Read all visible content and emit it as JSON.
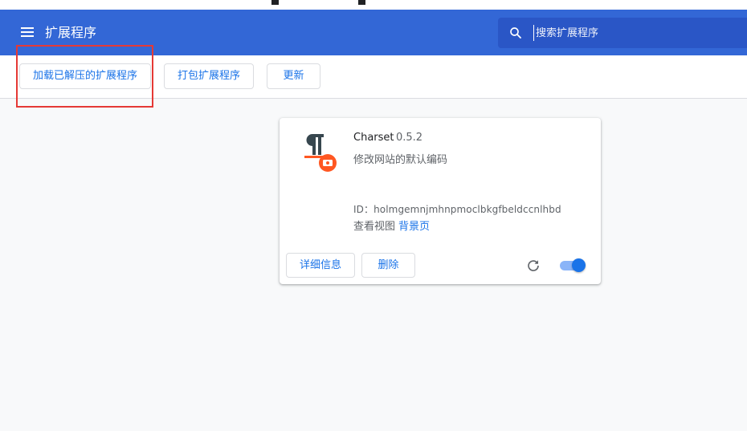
{
  "header": {
    "title": "扩展程序",
    "search_placeholder": "搜索扩展程序"
  },
  "toolbar": {
    "load_unpacked_label": "加载已解压的扩展程序",
    "pack_label": "打包扩展程序",
    "update_label": "更新"
  },
  "extension": {
    "name": "Charset",
    "version": "0.5.2",
    "description": "修改网站的默认编码",
    "id_text": "ID：holmgemnjmhnpmoclbkgfbeldccnlhbd",
    "inspect_label": "查看视图",
    "inspect_link": "背景页",
    "details_label": "详细信息",
    "remove_label": "删除",
    "enabled": true
  },
  "colors": {
    "header_bg": "#3367d6",
    "accent": "#1a73e8",
    "highlight": "#e53935"
  },
  "icons": {
    "menu": "hamburger-menu-icon",
    "search": "search-icon",
    "reload": "reload-icon",
    "extension_logo": "charset-pilcrow-icon"
  }
}
